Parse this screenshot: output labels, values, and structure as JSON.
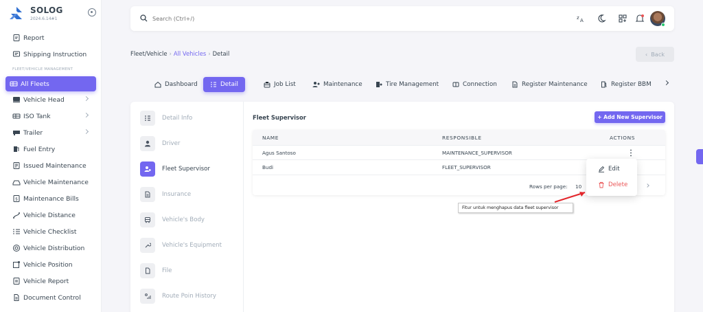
{
  "brand": {
    "name": "SOLOG",
    "version": "2024.6.14#1"
  },
  "sidebar": {
    "items_top": [
      {
        "label": "Report",
        "icon": "report-icon"
      },
      {
        "label": "Shipping Instruction",
        "icon": "shipping-instruction-icon"
      }
    ],
    "section_header": "FLEET/VEHICLE MANAGEMENT",
    "items": [
      {
        "label": "All Fleets",
        "icon": "fleet-icon",
        "active": true
      },
      {
        "label": "Vehicle Head",
        "icon": "truck-icon",
        "has_children": true
      },
      {
        "label": "ISO Tank",
        "icon": "tank-icon",
        "has_children": true
      },
      {
        "label": "Trailer",
        "icon": "trailer-icon",
        "has_children": true
      },
      {
        "label": "Fuel Entry",
        "icon": "fuel-icon"
      },
      {
        "label": "Issued Maintenance",
        "icon": "clipboard-icon"
      },
      {
        "label": "Vehicle Maintenance",
        "icon": "wrench-car-icon"
      },
      {
        "label": "Maintenance Bills",
        "icon": "bill-icon"
      },
      {
        "label": "Vehicle Distance",
        "icon": "route-icon"
      },
      {
        "label": "Vehicle Checklist",
        "icon": "checklist-icon"
      },
      {
        "label": "Vehicle Distribution",
        "icon": "distribution-icon"
      },
      {
        "label": "Vehicle Position",
        "icon": "map-pin-icon"
      },
      {
        "label": "Vehicle Report",
        "icon": "report-clipboard-icon"
      },
      {
        "label": "Document Control",
        "icon": "document-icon"
      }
    ]
  },
  "topbar": {
    "search_placeholder": "Search (Ctrl+/)"
  },
  "breadcrumb": {
    "root": "Fleet/Vehicle",
    "active": "All Vehicles",
    "current": "Detail"
  },
  "back_label": "Back",
  "tabs": [
    {
      "label": "Dashboard"
    },
    {
      "label": "Detail",
      "active": true
    },
    {
      "label": "Job List"
    },
    {
      "label": "Maintenance"
    },
    {
      "label": "Tire Management"
    },
    {
      "label": "Connection"
    },
    {
      "label": "Register Maintenance"
    },
    {
      "label": "Register BBM"
    }
  ],
  "left_menu": [
    {
      "label": "Detail Info"
    },
    {
      "label": "Driver"
    },
    {
      "label": "Fleet Supervisor",
      "active": true
    },
    {
      "label": "Insurance"
    },
    {
      "label": "Vehicle's Body"
    },
    {
      "label": "Vehicle's Equipment"
    },
    {
      "label": "File"
    },
    {
      "label": "Route Poin History"
    }
  ],
  "section": {
    "title": "Fleet Supervisor",
    "add_button": "+ Add New Supervisor"
  },
  "table": {
    "columns": [
      "NAME",
      "RESPONSIBLE",
      "ACTIONS"
    ],
    "rows": [
      {
        "name": "Agus Santoso",
        "responsible": "MAINTENANCE_SUPERVISOR"
      },
      {
        "name": "Budi",
        "responsible": "FLEET_SUPERVISOR"
      }
    ],
    "rows_per_page_label": "Rows per page:",
    "rows_per_page_value": "10"
  },
  "dropdown": {
    "edit": "Edit",
    "delete": "Delete"
  },
  "annotation": "Fitur untuk menghapus  data fleet supervisor",
  "colors": {
    "primary": "#7367f0",
    "danger": "#ea5455",
    "annotation_arrow": "#e3262b"
  }
}
